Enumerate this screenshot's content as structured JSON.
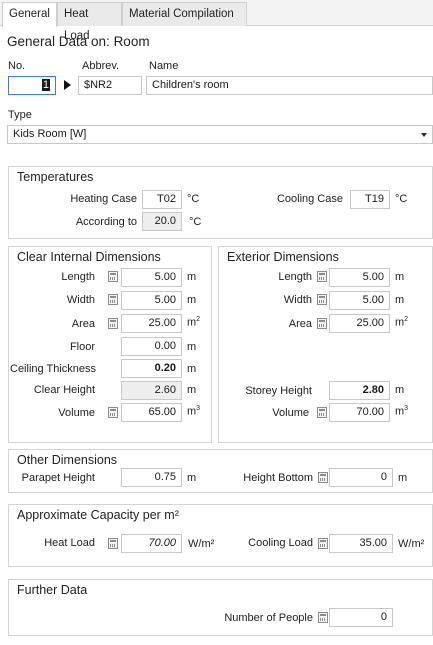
{
  "tabs": [
    {
      "label": "General"
    },
    {
      "label": "Heat Load"
    },
    {
      "label": "Material Compilation"
    }
  ],
  "general_heading": "General Data on: Room",
  "id_fields": {
    "no_label": "No.",
    "no_value": "1",
    "abbrev_label": "Abbrev.",
    "abbrev_value": "$NR2",
    "name_label": "Name",
    "name_value": "Children's room"
  },
  "type": {
    "label": "Type",
    "value": "Kids Room [W]"
  },
  "temperatures": {
    "title": "Temperatures",
    "heating_case_label": "Heating Case",
    "heating_case_value": "T02",
    "heating_case_unit": "°C",
    "cooling_case_label": "Cooling Case",
    "cooling_case_value": "T19",
    "cooling_case_unit": "°C",
    "according_to_label": "According to",
    "according_to_value": "20.0",
    "according_to_unit": "°C"
  },
  "clear_internal": {
    "title": "Clear Internal Dimensions",
    "length_label": "Length",
    "length_value": "5.00",
    "length_unit": "m",
    "width_label": "Width",
    "width_value": "5.00",
    "width_unit": "m",
    "area_label": "Area",
    "area_value": "25.00",
    "area_unit": "m",
    "floor_label": "Floor",
    "floor_value": "0.00",
    "floor_unit": "m",
    "ceiling_label": "Ceiling Thickness",
    "ceiling_value": "0.20",
    "ceiling_unit": "m",
    "clear_height_label": "Clear Height",
    "clear_height_value": "2.60",
    "clear_height_unit": "m",
    "volume_label": "Volume",
    "volume_value": "65.00",
    "volume_unit": "m"
  },
  "exterior": {
    "title": "Exterior Dimensions",
    "length_label": "Length",
    "length_value": "5.00",
    "length_unit": "m",
    "width_label": "Width",
    "width_value": "5.00",
    "width_unit": "m",
    "area_label": "Area",
    "area_value": "25.00",
    "area_unit": "m",
    "storey_label": "Storey Height",
    "storey_value": "2.80",
    "storey_unit": "m",
    "volume_label": "Volume",
    "volume_value": "70.00",
    "volume_unit": "m"
  },
  "other": {
    "title": "Other Dimensions",
    "parapet_label": "Parapet Height",
    "parapet_value": "0.75",
    "parapet_unit": "m",
    "height_bottom_label": "Height Bottom",
    "height_bottom_value": "0",
    "height_bottom_unit": "m"
  },
  "capacity": {
    "title": "Approximate Capacity per m²",
    "heat_load_label": "Heat Load",
    "heat_load_value": "70.00",
    "heat_load_unit": "W/m²",
    "cooling_load_label": "Cooling Load",
    "cooling_load_value": "35.00",
    "cooling_load_unit": "W/m²"
  },
  "further": {
    "title": "Further Data",
    "people_label": "Number of People",
    "people_value": "0"
  },
  "superscripts": {
    "sq": "2",
    "cube": "3"
  }
}
